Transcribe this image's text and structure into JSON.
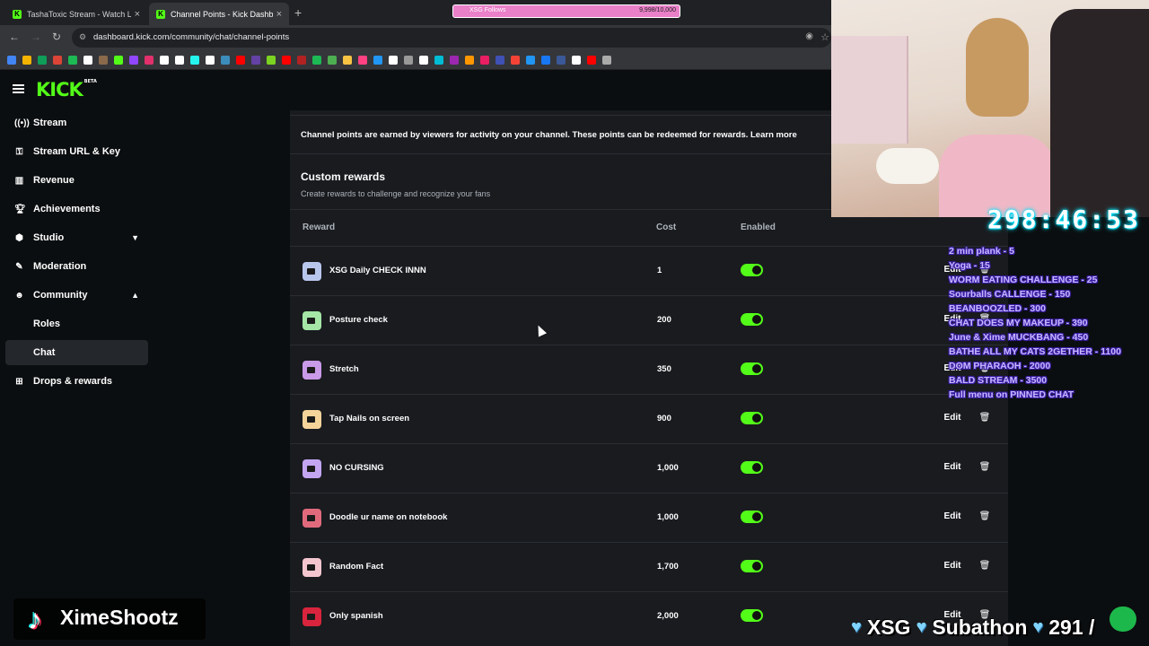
{
  "browser": {
    "tabs": [
      {
        "title": "TashaToxic Stream - Watch Live",
        "favicon": "K"
      },
      {
        "title": "Channel Points - Kick Dashboar",
        "favicon": "K"
      }
    ],
    "url": "dashboard.kick.com/community/chat/channel-points",
    "follow_goal": {
      "label": "XSG Follows",
      "current": "9,998",
      "target": "10,000",
      "progress": 0.9998,
      "color": "#e980c8"
    }
  },
  "kick": {
    "logo": "KICK",
    "beta": "BETA",
    "accent": "#53fc18",
    "sidebar": [
      {
        "label": "Stream",
        "icon": "broadcast-icon"
      },
      {
        "label": "Stream URL & Key",
        "icon": "key-icon"
      },
      {
        "label": "Revenue",
        "icon": "revenue-icon"
      },
      {
        "label": "Achievements",
        "icon": "trophy-icon"
      },
      {
        "label": "Studio",
        "icon": "studio-icon",
        "chevron": "down"
      },
      {
        "label": "Moderation",
        "icon": "wrench-icon"
      },
      {
        "label": "Community",
        "icon": "community-icon",
        "chevron": "up"
      },
      {
        "label": "Roles"
      },
      {
        "label": "Chat"
      },
      {
        "label": "Drops & rewards",
        "icon": "gift-icon"
      }
    ],
    "info_text": "Channel points are earned by viewers for activity on your channel. These points can be redeemed for rewards. Learn more",
    "section_title": "Custom rewards",
    "section_subtitle": "Create rewards to challenge and recognize your fans",
    "columns": {
      "reward": "Reward",
      "cost": "Cost",
      "enabled": "Enabled"
    },
    "edit_label": "Edit",
    "rewards": [
      {
        "name": "XSG Daily CHECK INNN",
        "cost": "1",
        "color": "#b9c6ec"
      },
      {
        "name": "Posture check",
        "cost": "200",
        "color": "#a5e6a6"
      },
      {
        "name": "Stretch",
        "cost": "350",
        "color": "#c99ae8"
      },
      {
        "name": "Tap Nails on screen",
        "cost": "900",
        "color": "#f5d49a"
      },
      {
        "name": "NO CURSING",
        "cost": "1,000",
        "color": "#c3a5f2"
      },
      {
        "name": "Doodle ur name on notebook",
        "cost": "1,000",
        "color": "#e06a7c"
      },
      {
        "name": "Random Fact",
        "cost": "1,700",
        "color": "#f3c6cf"
      },
      {
        "name": "Only spanish",
        "cost": "2,000",
        "color": "#d8243c"
      }
    ]
  },
  "overlay": {
    "timer": "298:46:53",
    "menu": [
      "2 min plank - 5",
      "Yoga - 15",
      "WORM EATING CHALLENGE - 25",
      "Sourballs CALLENGE - 150",
      "BEANBOOZLED - 300",
      "CHAT DOES MY MAKEUP - 390",
      "June & Xime MUCKBANG - 450",
      "BATHE ALL MY CATS 2GETHER - 1100",
      "DOM PHARAOH - 2000",
      "BALD STREAM - 3500",
      "Full menu on PINNED CHAT"
    ],
    "tiktok_handle": "XimeShootz",
    "subathon": {
      "xsg": "XSG",
      "label": "Subathon",
      "count": "291 /"
    }
  }
}
